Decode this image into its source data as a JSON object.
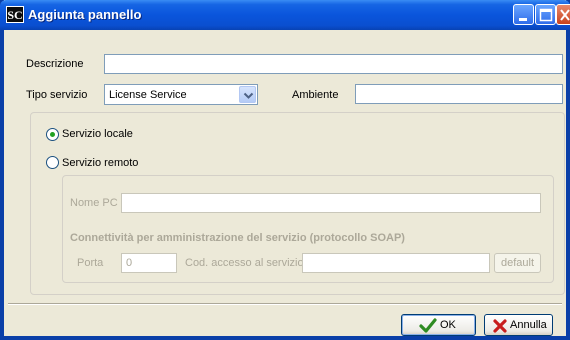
{
  "window": {
    "app_icon": "SC",
    "title": "Aggiunta pannello"
  },
  "form": {
    "descrizione_label": "Descrizione",
    "descrizione_value": "",
    "tipo_servizio_label": "Tipo servizio",
    "tipo_servizio_value": "License Service",
    "ambiente_label": "Ambiente",
    "ambiente_value": ""
  },
  "service": {
    "locale_label": "Servizio locale",
    "locale_selected": true,
    "remoto_label": "Servizio remoto",
    "remoto_selected": false
  },
  "remote": {
    "nome_pc_label": "Nome PC",
    "nome_pc_value": "",
    "connectivity_heading": "Connettività per amministrazione del servizio (protocollo SOAP)",
    "porta_label": "Porta",
    "porta_value": "0",
    "cod_accesso_label": "Cod. accesso al servizio",
    "cod_accesso_value": "",
    "default_label": "default"
  },
  "buttons": {
    "ok_label": "OK",
    "annulla_label": "Annulla"
  },
  "colors": {
    "title_bar": "#0a55dc",
    "dialog_bg": "#ece9d8",
    "ok_check": "#2e8b22",
    "cancel_x": "#c81e1e",
    "radio_dot": "#21a121"
  }
}
